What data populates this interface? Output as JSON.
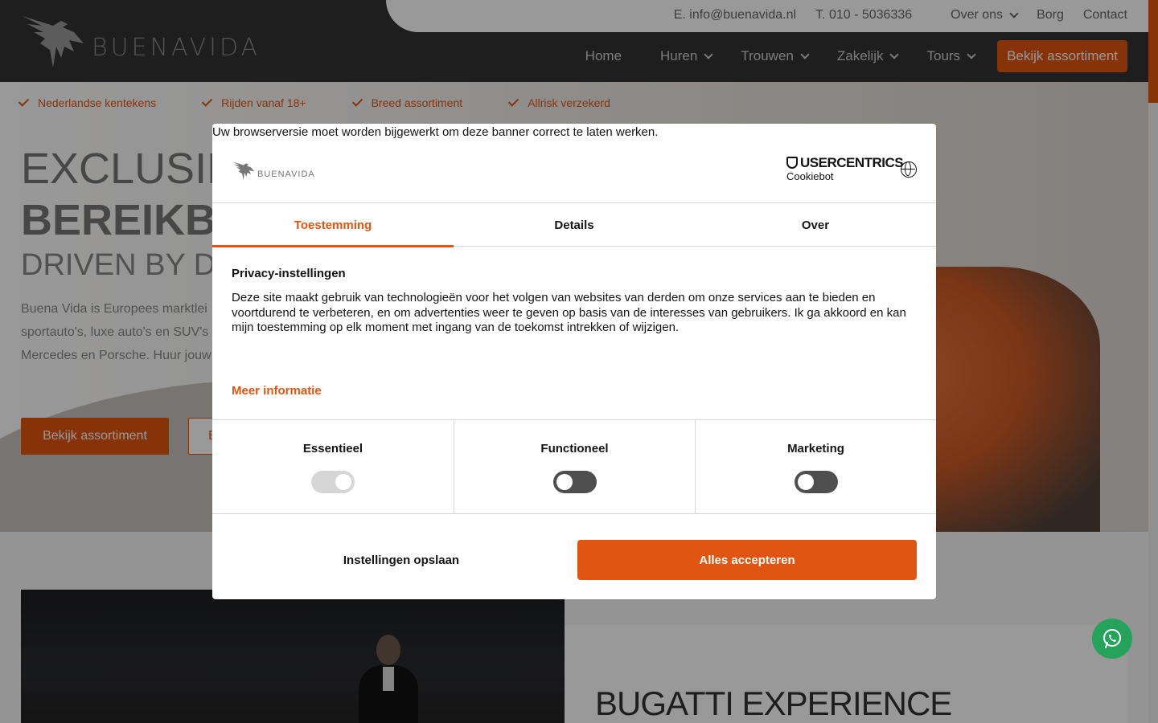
{
  "topbar": {
    "email": "E. info@buenavida.nl",
    "phone": "T. 010 - 5036336",
    "about": "Over ons",
    "deposit": "Borg",
    "contact": "Contact"
  },
  "logo": {
    "text": "BUENAVIDA"
  },
  "nav": {
    "home": "Home",
    "rent": "Huren",
    "wedding": "Trouwen",
    "business": "Zakelijk",
    "tours": "Tours",
    "cta": "Bekijk assortiment"
  },
  "hero": {
    "usps": [
      "Nederlandse kentekens",
      "Rijden vanaf 18+",
      "Breed assortiment",
      "Allrisk verzekerd"
    ],
    "line1": "EXCLUSIE",
    "line2": "BEREIKBA",
    "line3": "DRIVEN BY D",
    "paragraph": "Buena Vida is Europees marktlei sportauto's, luxe auto's en SUV's Mercedes en Porsche. Huur jouw",
    "button_primary": "Bekijk assortiment",
    "button_secondary": "B"
  },
  "section": {
    "card_title": "BUGATTI EXPERIENCE"
  },
  "cookie_dialog": {
    "browser_notice": "Uw browserversie moet worden bijgewerkt om deze banner correct te laten werken.",
    "logo_text": "BUENAVIDA",
    "provider_top": "USERCENTRICS",
    "provider_bottom": "Cookiebot",
    "tabs": [
      "Toestemming",
      "Details",
      "Over"
    ],
    "active_tab": "Toestemming",
    "title": "Privacy-instellingen",
    "body": "Deze site maakt gebruik van technologieën voor het volgen van websites van derden om onze services aan te bieden en voortdurend te verbeteren, en om advertenties weer te geven op basis van de interesses van gebruikers. Ik ga akkoord en kan mijn toestemming op elk moment met ingang van de toekomst intrekken of wijzigen.",
    "more_info": "Meer informatie",
    "categories": [
      {
        "label": "Essentieel",
        "enabled": true,
        "disabled": true
      },
      {
        "label": "Functioneel",
        "enabled": false,
        "disabled": false
      },
      {
        "label": "Marketing",
        "enabled": false,
        "disabled": false
      }
    ],
    "save_label": "Instellingen opslaan",
    "accept_label": "Alles accepteren"
  },
  "colors": {
    "accent": "#e05511",
    "header_bg": "#333333",
    "whatsapp": "#25a35a"
  },
  "icons": [
    "chevron-down-icon",
    "check-icon",
    "globe-icon",
    "shield-icon",
    "whatsapp-icon",
    "eagle-logo"
  ]
}
